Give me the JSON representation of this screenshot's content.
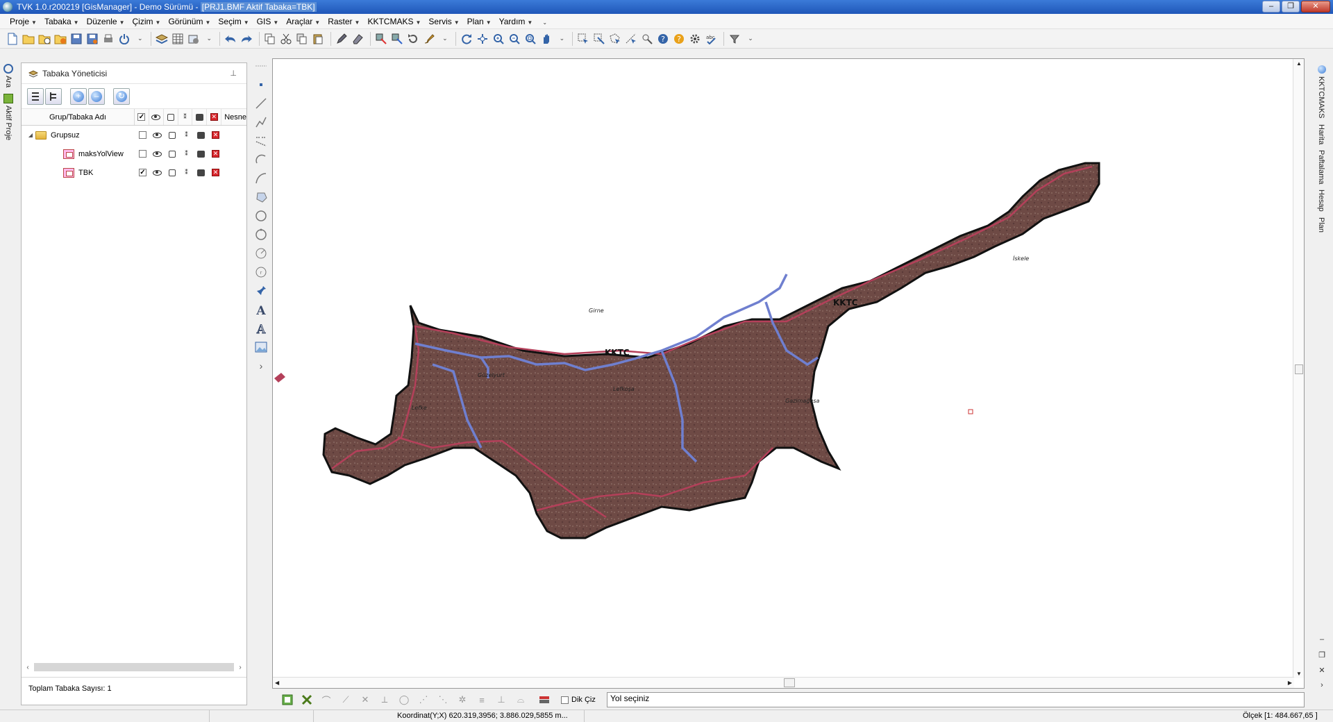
{
  "window": {
    "title": "TVK 1.0.r200219 [GisManager] - Demo Sürümü - [PRJ1.BMF  Aktif Tabaka=TBK]",
    "title_prefix": "TVK 1.0.r200219 [GisManager] - Demo Sürümü - ",
    "title_highlight": "[PRJ1.BMF  Aktif Tabaka=TBK]",
    "minimize": "–",
    "maximize": "❐",
    "close": "✕"
  },
  "menu": [
    {
      "label": "Proje"
    },
    {
      "label": "Tabaka"
    },
    {
      "label": "Düzenle"
    },
    {
      "label": "Çizim"
    },
    {
      "label": "Görünüm"
    },
    {
      "label": "Seçim"
    },
    {
      "label": "GIS"
    },
    {
      "label": "Araçlar"
    },
    {
      "label": "Raster"
    },
    {
      "label": "KKTCMAKS"
    },
    {
      "label": "Servis"
    },
    {
      "label": "Plan"
    },
    {
      "label": "Yardım"
    }
  ],
  "left_tabs": [
    "Ara",
    "Aktif Proje"
  ],
  "right_tabs": [
    "KKTCMAKS",
    "Harita",
    "Paftalama",
    "Hesap",
    "Plan"
  ],
  "layer_manager": {
    "title": "Tabaka Yöneticisi",
    "pin": "⊥",
    "column_name": "Grup/Tabaka Adı",
    "column_nesne": "Nesne",
    "rows": [
      {
        "name": "Grupsuz",
        "type": "group",
        "checked": false
      },
      {
        "name": "maksYolView",
        "type": "layer",
        "checked": false
      },
      {
        "name": "TBK",
        "type": "layer",
        "checked": true
      }
    ],
    "footer": "Toplam Tabaka Sayısı: 1"
  },
  "map": {
    "background": "#ffffff",
    "land_fill": "#6e4a45",
    "boundary_color": "#b4405a",
    "road_color": "#6f7fcf",
    "labels": [
      {
        "text": "KKTC"
      },
      {
        "text": "KKTC"
      },
      {
        "text": "Girne"
      },
      {
        "text": "Güzelyurt"
      },
      {
        "text": "Lefke"
      },
      {
        "text": "Lefkoşa"
      },
      {
        "text": "Gazimağusa"
      },
      {
        "text": "İskele"
      }
    ]
  },
  "command_bar": {
    "ortho_label": "Dik Çiz",
    "ortho_checked": false,
    "prompt": "Yol seçiniz"
  },
  "status": {
    "coordinate": "Koordinat(Y;X)  620.319,3956; 3.886.029,5855 m...",
    "scale": "Ölçek [1: 484.667,65 ]"
  },
  "colors": {
    "titlebar": "#2b66c6",
    "accent": "#3a7bd5"
  }
}
